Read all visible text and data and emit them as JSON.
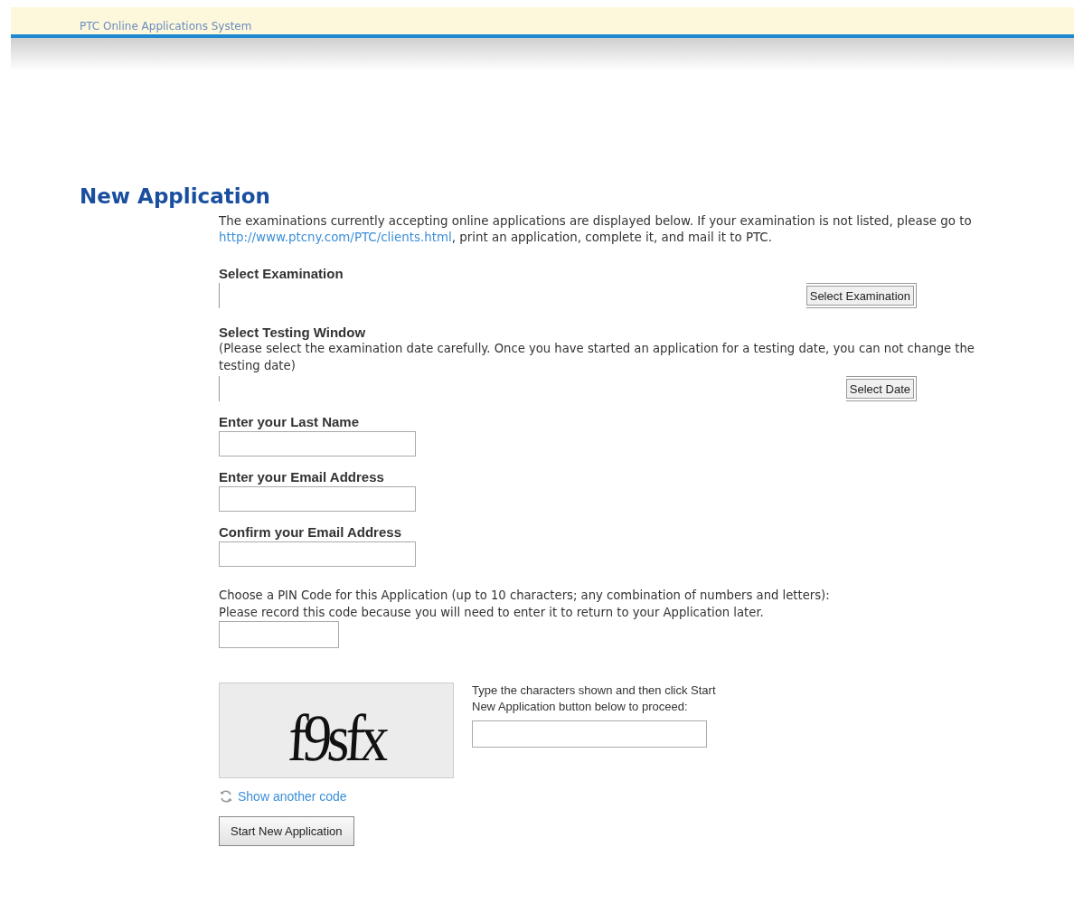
{
  "header": {
    "title": "PTC Online Applications System"
  },
  "page_title": "New Application",
  "intro": {
    "before": "The examinations currently accepting online applications are displayed below. If your examination is not listed, please go to ",
    "link": "http://www.ptcny.com/PTC/clients.html",
    "after": ", print an application, complete it, and mail it to PTC."
  },
  "exam_field": {
    "label": "Select Examination",
    "button": "Select Examination"
  },
  "window_field": {
    "label": "Select Testing Window",
    "note": "(Please select the examination date carefully. Once you have started an application for a testing date, you can not change the testing date)",
    "button": "Select Date"
  },
  "fields": [
    {
      "label": "Enter your Last Name"
    },
    {
      "label": "Enter your Email Address"
    },
    {
      "label": "Confirm your Email Address"
    }
  ],
  "pin": {
    "label": "Choose a PIN Code for this Application (up to 10 characters; any combination of numbers and letters):",
    "note": "Please record this code because you will need to enter it to return to your Application later."
  },
  "captcha": {
    "code": "f9sfx",
    "instructions": "Type the characters shown and then click Start New Application button below to proceed:",
    "refresh_link": "Show another code"
  },
  "submit_button": "Start New Application"
}
